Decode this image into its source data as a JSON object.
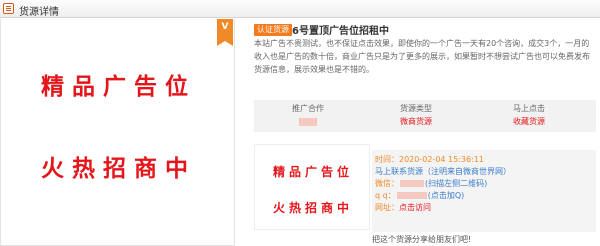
{
  "header": {
    "title": "货源详情",
    "icon": "list-icon"
  },
  "ad_left": {
    "line1": "精品广告位",
    "line2": "火热招商中",
    "badge": "V"
  },
  "listing": {
    "tag": "认证货源",
    "title": "6号置顶广告位招租中",
    "description": "本站广告不贵测试，也不保证点击效果，即使你的一个广告一天有20个咨询，成交3个，一月的收入也是广告的数十倍，商业广告只是为了更多的展示，如果暂时不想尝试广告也可以免费发布货源信息，展示效果也是不错的。"
  },
  "stats": [
    {
      "label": "推广合作",
      "value": ""
    },
    {
      "label": "货源类型",
      "value": "微商货源"
    },
    {
      "label": "马上点击",
      "value": "收藏货源"
    }
  ],
  "ad_card": {
    "line1": "精品广告位",
    "line2": "火热招商中"
  },
  "contact": {
    "time_label": "时间：",
    "time_value": "2020-02-04 15:36:11",
    "contact_label": "马上联系货源",
    "contact_note": "（注明来自微商世界网）",
    "wechat_label": "微信：",
    "wechat_note": "(扫描左侧二维码)",
    "qq_label": "q q：",
    "qq_note": "(点击加Q)",
    "site_label": "网址：",
    "site_value": "点击访问"
  },
  "share": "把这个货源分享给朋友们吧!"
}
